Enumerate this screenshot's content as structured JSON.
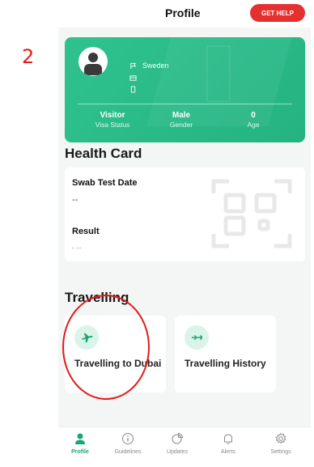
{
  "annotation": {
    "step_number": "2"
  },
  "header": {
    "title": "Profile",
    "help_button": "GET HELP"
  },
  "profile": {
    "country": "Sweden",
    "country_icon": "flag-icon",
    "id_icon": "id-card-icon",
    "phone_icon": "phone-icon",
    "visa_status_value": "Visitor",
    "visa_status_label": "Visa Status",
    "gender_value": "Male",
    "gender_label": "Gender",
    "age_value": "0",
    "age_label": "Age"
  },
  "health_card": {
    "title": "Health Card",
    "swab_label": "Swab Test Date",
    "swab_value": "--",
    "result_label": "Result",
    "result_value": "- --"
  },
  "travelling": {
    "title": "Travelling",
    "cards": [
      {
        "label": "Travelling to Dubai",
        "icon": "airplane-icon"
      },
      {
        "label": "Travelling History",
        "icon": "arrows-icon"
      }
    ]
  },
  "nav": {
    "items": [
      {
        "label": "Profile",
        "icon": "person-icon",
        "active": true
      },
      {
        "label": "Guidelines",
        "icon": "info-icon"
      },
      {
        "label": "Updates",
        "icon": "pie-chart-icon"
      },
      {
        "label": "Alerts",
        "icon": "bell-icon"
      },
      {
        "label": "Settings",
        "icon": "gear-icon"
      }
    ]
  },
  "colors": {
    "brand": "#24b381",
    "danger": "#e53030",
    "annotation": "#e31b1b"
  }
}
